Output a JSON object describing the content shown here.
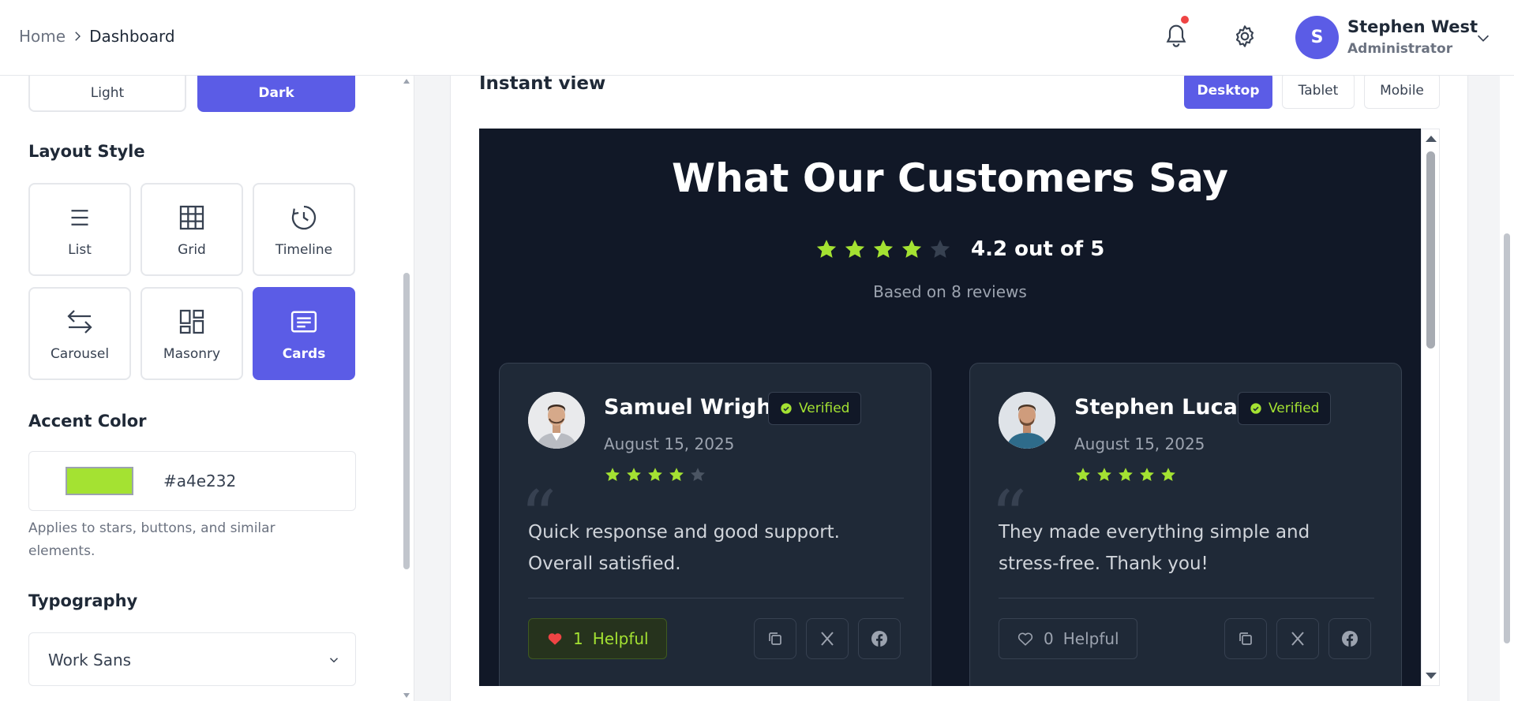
{
  "header": {
    "breadcrumb": {
      "home": "Home",
      "current": "Dashboard"
    },
    "user": {
      "initial": "S",
      "name": "Stephen West",
      "role": "Administrator"
    }
  },
  "sidebar": {
    "theme": {
      "light_label": "Light",
      "dark_label": "Dark",
      "selected": "Dark"
    },
    "layout_style": {
      "label": "Layout Style",
      "options": [
        "List",
        "Grid",
        "Timeline",
        "Carousel",
        "Masonry",
        "Cards"
      ],
      "selected": "Cards"
    },
    "accent": {
      "label": "Accent Color",
      "value": "#a4e232",
      "helper": "Applies to stars, buttons, and similar elements."
    },
    "typography": {
      "label": "Typography",
      "font": "Work Sans"
    }
  },
  "main": {
    "title": "Instant view",
    "devices": [
      "Desktop",
      "Tablet",
      "Mobile"
    ],
    "selected_device": "Desktop"
  },
  "preview": {
    "heading": "What Our Customers Say",
    "rating_value": 4.2,
    "rating_text": "4.2 out of 5",
    "based_on": "Based on 8 reviews",
    "reviews": [
      {
        "name": "Samuel Wright",
        "verified_label": "Verified",
        "date": "August 15, 2025",
        "stars": 4,
        "text": "Quick response and good support. Overall satisfied.",
        "helpful_count": "1",
        "helpful_label": "Helpful",
        "helpful_active": true
      },
      {
        "name": "Stephen Lucas",
        "verified_label": "Verified",
        "date": "August 15, 2025",
        "stars": 5,
        "text": "They made everything simple and stress-free. Thank you!",
        "helpful_count": "0",
        "helpful_label": "Helpful",
        "helpful_active": false
      }
    ]
  },
  "colors": {
    "accent": "#a4e232",
    "primary": "#5b5ce6",
    "preview_bg": "#111827",
    "card_bg": "#1f2937"
  },
  "icons": [
    "chevron-right-icon",
    "bell-icon",
    "gear-icon",
    "chevron-down-icon",
    "list-icon",
    "grid-icon",
    "clock-icon",
    "arrows-swap-icon",
    "masonry-icon",
    "cards-icon",
    "star-icon",
    "check-circle-icon",
    "heart-icon",
    "copy-icon",
    "x-logo-icon",
    "facebook-icon"
  ]
}
